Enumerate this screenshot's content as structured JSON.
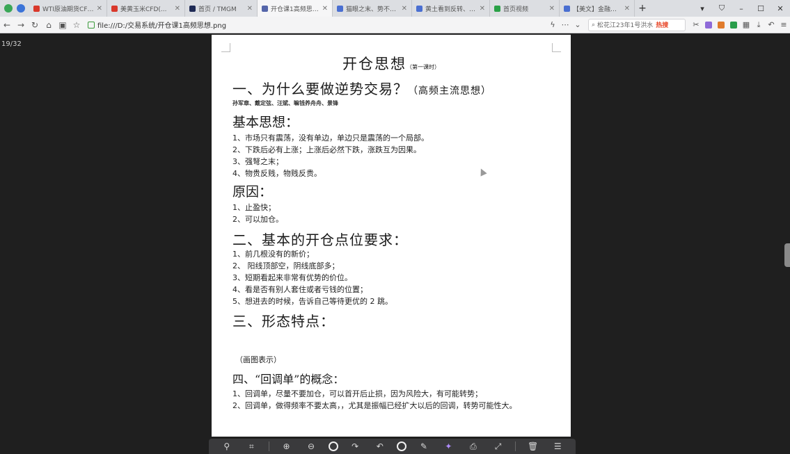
{
  "browser": {
    "tabs": [
      {
        "title": "WTI原油期货CFD(...",
        "active": false,
        "color": "#d9382b"
      },
      {
        "title": "美黄玉米CFD(...",
        "active": false,
        "color": "#d9382b"
      },
      {
        "title": "首页 / TMGM",
        "active": false,
        "color": "#1f2a55"
      },
      {
        "title": "开仓课1高频思想.p...",
        "active": true,
        "color": "#5566aa"
      },
      {
        "title": "猫眼之末、势不能...",
        "active": false,
        "color": "#4a6fd1"
      },
      {
        "title": "黄土看到反转、跳...",
        "active": false,
        "color": "#4a6fd1"
      },
      {
        "title": "首页视频",
        "active": false,
        "color": "#2aa147"
      },
      {
        "title": "",
        "active": false,
        "color": "#cccccc"
      },
      {
        "title": "【美文】金融期货...",
        "active": false,
        "color": "#4a6fd1"
      }
    ],
    "new_tab_label": "+",
    "url": "file:///D:/交易系统/开仓课1高频思想.png",
    "search_placeholder": "松花江23年1号洪水",
    "search_hot": "热搜",
    "page_counter": "19/32"
  },
  "document": {
    "title": "开仓思想",
    "title_note": "（第一课时）",
    "section1": {
      "heading": "一、为什么要做逆势交易？",
      "subheading": "（高频主流思想）",
      "names": "孙军章、戴定弦、汪斌、嘛钱养舟舟、景锋",
      "basic_heading": "基本思想：",
      "basic_items": [
        "1、市场只有震荡，没有单边，单边只是震荡的一个局部。",
        "2、下跌后必有上涨；上涨后必然下跌，涨跌互为因果。",
        "3、强弩之末；",
        "4、物贵反贱，物贱反贵。"
      ],
      "reason_heading": "原因：",
      "reason_items": [
        "1、止盈快；",
        "2、可以加仓。"
      ]
    },
    "section2": {
      "heading": "二、基本的开仓点位要求：",
      "items": [
        "1、前几根没有的新价；",
        "2、 阳线顶部空，阴线底部多；",
        "3、短期看起来非常有优势的价位。",
        "4、看是否有别人套住或者亏钱的位置；",
        "5、想进去的时候，告诉自己等待更优的 2 跳。"
      ]
    },
    "section3": {
      "heading": "三、形态特点：",
      "note": "（画图表示）"
    },
    "section4": {
      "heading": "四、“回调单”的概念：",
      "items": [
        "1、回调单，尽量不要加仓，可以首开后止损，因为风险大，有可能转势；",
        "2、回调单，做得频率不要太高，，尤其是振幅已经扩大以后的回调，转势可能性大。"
      ]
    }
  }
}
